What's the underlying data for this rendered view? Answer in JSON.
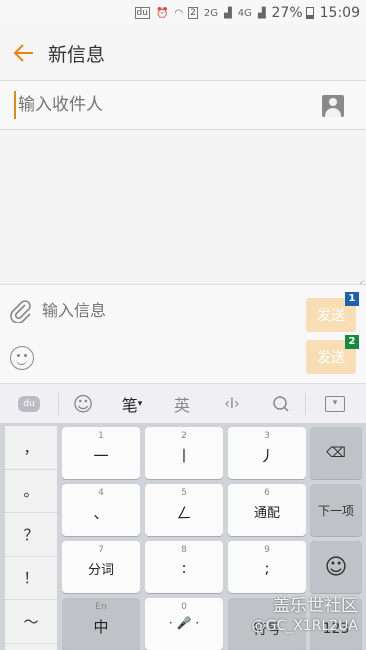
{
  "status_bar": {
    "carrier_badge": "du",
    "sim_badge": "2",
    "network_2g": "2G",
    "network_4g": "4G",
    "battery": "27%",
    "time": "15:09"
  },
  "app_bar": {
    "title": "新信息"
  },
  "recipient": {
    "placeholder": "输入收件人"
  },
  "compose": {
    "placeholder": "输入信息",
    "send_labels": [
      "发送",
      "发送"
    ],
    "sim_slots": [
      "1",
      "2"
    ]
  },
  "keyboard_toolbar": {
    "items": [
      "du",
      "☺",
      "笔",
      "英",
      "‹I›",
      "Q",
      "▾"
    ],
    "active_index": 2
  },
  "keyboard": {
    "punctuation": [
      "，",
      "。",
      "？",
      "！",
      "～"
    ],
    "rows": [
      [
        {
          "hint": "1",
          "main": "一"
        },
        {
          "hint": "2",
          "main": "丨"
        },
        {
          "hint": "3",
          "main": "丿"
        }
      ],
      [
        {
          "hint": "4",
          "main": "、"
        },
        {
          "hint": "5",
          "main": "ㄥ"
        },
        {
          "hint": "6",
          "main": "通配"
        }
      ],
      [
        {
          "hint": "7",
          "main": "分词"
        },
        {
          "hint": "8",
          "main": ":"
        },
        {
          "hint": "9",
          "main": ";"
        }
      ],
      [
        {
          "hint": "En",
          "main": "中"
        },
        {
          "hint": "0",
          "main": "· 🎤 ·"
        },
        {
          "hint": "",
          "main": "符号"
        }
      ]
    ],
    "side_keys": [
      "⌫",
      "下一项",
      "☺",
      "123"
    ]
  },
  "watermark": {
    "line1": "盖乐世社区",
    "line2": "@GC_X1RL2UA"
  }
}
